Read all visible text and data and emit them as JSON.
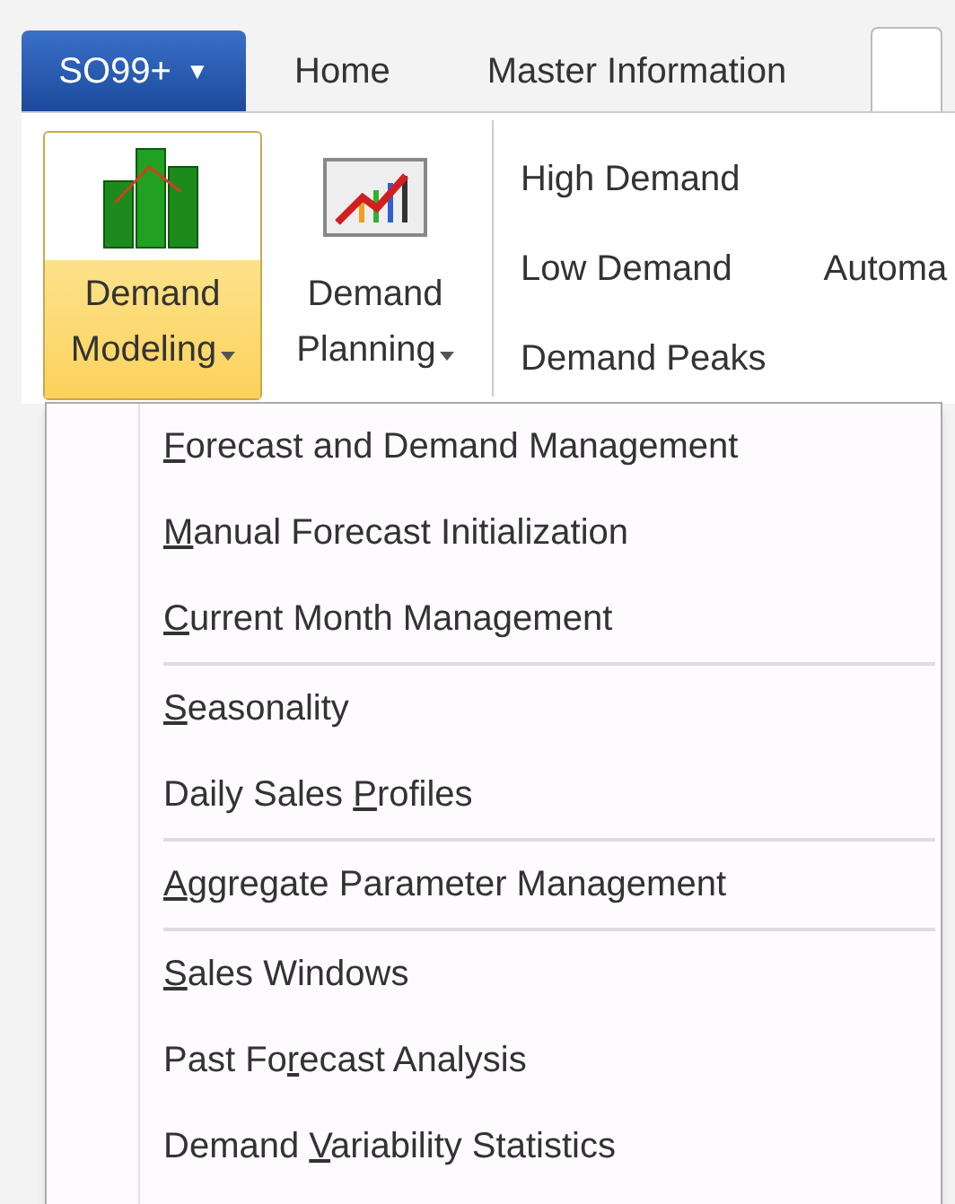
{
  "app_button": {
    "label": "SO99+",
    "caret": "▼"
  },
  "tabs": [
    {
      "label": "Home",
      "selected": false
    },
    {
      "label": "Master Information",
      "selected": false
    },
    {
      "selected": true
    }
  ],
  "ribbon": {
    "large_buttons": [
      {
        "line1": "Demand",
        "line2": "Modeling",
        "kind": "chart",
        "selected": true
      },
      {
        "line1": "Demand",
        "line2": "Planning",
        "kind": "trend",
        "selected": false
      }
    ],
    "small_buttons": [
      {
        "label": "High Demand"
      },
      {
        "label": "Low Demand"
      },
      {
        "label": "Demand Peaks"
      }
    ],
    "cut_button": {
      "label": "Automa"
    }
  },
  "menu": {
    "groups": [
      {
        "items": [
          {
            "key": "F",
            "after": "orecast and Demand Management"
          },
          {
            "key": "M",
            "after": "anual Forecast Initialization"
          },
          {
            "key": "C",
            "after": "urrent Month Management"
          }
        ]
      },
      {
        "items": [
          {
            "key": "S",
            "after": "easonality"
          },
          {
            "before": "Daily Sales ",
            "key": "P",
            "after": "rofiles"
          }
        ]
      },
      {
        "items": [
          {
            "key": "A",
            "after": "ggregate Parameter Management"
          }
        ]
      },
      {
        "items": [
          {
            "key": "S",
            "after": "ales Windows"
          },
          {
            "before": "Past Fo",
            "key": "r",
            "after": "ecast Analysis"
          },
          {
            "before": "Demand ",
            "key": "V",
            "after": "ariability Statistics"
          }
        ]
      }
    ]
  }
}
